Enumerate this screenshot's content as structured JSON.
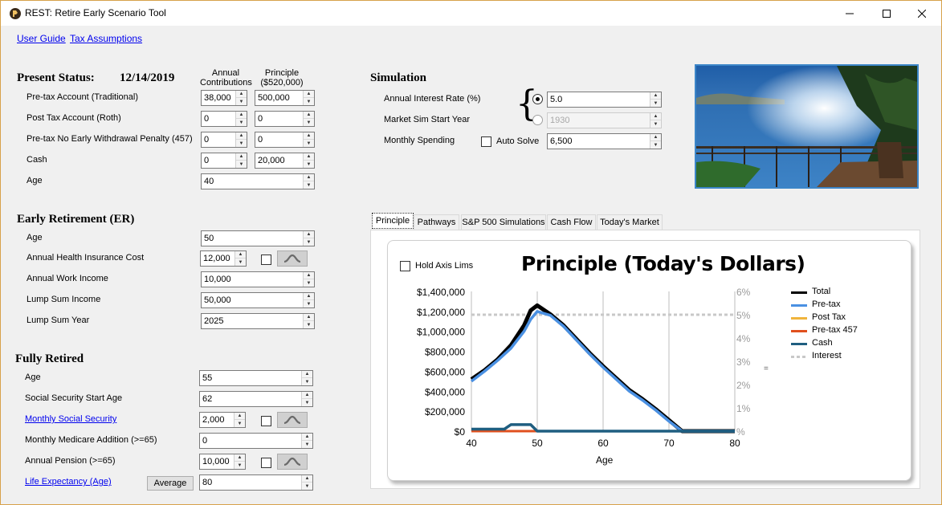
{
  "window": {
    "title": "REST: Retire Early Scenario Tool"
  },
  "links": {
    "user_guide": "User Guide",
    "tax_assumptions": "Tax Assumptions"
  },
  "present": {
    "heading": "Present Status:",
    "date": "12/14/2019",
    "col_contrib": "Annual\nContributions",
    "col_contrib_1": "Annual",
    "col_contrib_2": "Contributions",
    "col_principle_1": "Principle",
    "col_principle_2": "($520,000)",
    "rows": [
      {
        "label": "Pre-tax Account (Traditional)",
        "contrib": "38,000",
        "principle": "500,000"
      },
      {
        "label": "Post Tax Account (Roth)",
        "contrib": "0",
        "principle": "0"
      },
      {
        "label": "Pre-tax No Early Withdrawal Penalty (457)",
        "contrib": "0",
        "principle": "0"
      },
      {
        "label": "Cash",
        "contrib": "0",
        "principle": "20,000"
      }
    ],
    "age_label": "Age",
    "age_value": "40"
  },
  "early": {
    "heading": "Early Retirement (ER)",
    "age_label": "Age",
    "age_value": "50",
    "health_label": "Annual Health Insurance Cost",
    "health_value": "12,000",
    "work_label": "Annual Work Income",
    "work_value": "10,000",
    "lump_label": "Lump Sum Income",
    "lump_value": "50,000",
    "lump_year_label": "Lump Sum Year",
    "lump_year_value": "2025"
  },
  "fully": {
    "heading": "Fully Retired",
    "age_label": "Age",
    "age_value": "55",
    "ss_start_label": "Social Security Start Age",
    "ss_start_value": "62",
    "ss_monthly_label": "Monthly Social Security",
    "ss_monthly_value": "2,000",
    "medicare_label": "Monthly Medicare Addition (>=65)",
    "medicare_value": "0",
    "pension_label": "Annual Pension (>=65)",
    "pension_value": "10,000",
    "life_label": "Life Expectancy (Age)",
    "average_button": "Average",
    "life_value": "80"
  },
  "simulation": {
    "heading": "Simulation",
    "interest_label": "Annual Interest Rate (%)",
    "interest_value": "5.0",
    "market_label": "Market Sim Start Year",
    "market_value": "1930",
    "spending_label": "Monthly Spending",
    "autosolve_label": "Auto Solve",
    "spending_value": "6,500",
    "brace": "{"
  },
  "tabs": [
    "Principle",
    "Pathways",
    "S&P 500 Simulations",
    "Cash Flow",
    "Today's Market"
  ],
  "hold_axis_label": "Hold Axis Lims",
  "colors": {
    "total": "#000000",
    "pretax": "#4a90e2",
    "posttax": "#f0b43c",
    "pretax457": "#e0501e",
    "cash": "#1f5e80",
    "interest": "#c8c8c8",
    "link": "#0000ee",
    "photo_border": "#3c86c8"
  },
  "chart_data": {
    "type": "line",
    "title": "Principle (Today's Dollars)",
    "xlabel": "Age",
    "ylabel": "",
    "xlim": [
      40,
      80
    ],
    "ylim": [
      0,
      1400000
    ],
    "y2lim": [
      0,
      6
    ],
    "x_ticks": [
      "40",
      "50",
      "60",
      "70",
      "80"
    ],
    "y_ticks": [
      "$0",
      "$200,000",
      "$400,000",
      "$600,000",
      "$800,000",
      "$1,000,000",
      "$1,200,000",
      "$1,400,000"
    ],
    "y2_ticks": [
      "%",
      "1%",
      "2%",
      "3%",
      "4%",
      "5%",
      "6%"
    ],
    "legend_position": "right",
    "grid": "vertical",
    "series": [
      {
        "name": "Total",
        "color": "#000000",
        "x": [
          40,
          42,
          44,
          46,
          48,
          49,
          50,
          52,
          54,
          56,
          58,
          60,
          62,
          64,
          66,
          68,
          70,
          72,
          80
        ],
        "y": [
          520000,
          610000,
          720000,
          860000,
          1060000,
          1210000,
          1260000,
          1170000,
          1060000,
          920000,
          780000,
          650000,
          530000,
          410000,
          320000,
          220000,
          110000,
          0,
          0
        ]
      },
      {
        "name": "Pre-tax",
        "color": "#4a90e2",
        "x": [
          40,
          42,
          44,
          46,
          48,
          49,
          50,
          52,
          54,
          56,
          58,
          60,
          62,
          64,
          66,
          68,
          70,
          72,
          80
        ],
        "y": [
          500000,
          600000,
          710000,
          830000,
          1000000,
          1120000,
          1200000,
          1160000,
          1050000,
          910000,
          770000,
          640000,
          520000,
          400000,
          310000,
          210000,
          100000,
          0,
          0
        ]
      },
      {
        "name": "Post Tax",
        "color": "#f0b43c",
        "x": [
          40,
          80
        ],
        "y": [
          0,
          0
        ]
      },
      {
        "name": "Pre-tax 457",
        "color": "#e0501e",
        "x": [
          40,
          50,
          80
        ],
        "y": [
          0,
          0,
          0
        ]
      },
      {
        "name": "Cash",
        "color": "#1f5e80",
        "x": [
          40,
          45,
          46,
          49,
          50,
          80
        ],
        "y": [
          20000,
          20000,
          65000,
          65000,
          0,
          0
        ]
      },
      {
        "name": "Interest",
        "color": "#c8c8c8",
        "axis": "y2",
        "x": [
          40,
          80
        ],
        "y": [
          5.0,
          5.0
        ]
      }
    ]
  }
}
